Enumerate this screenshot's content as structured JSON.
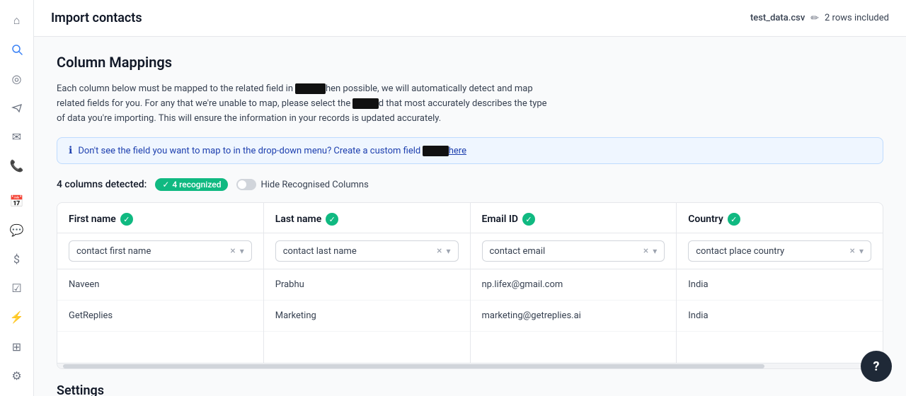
{
  "header": {
    "title": "Import contacts",
    "file_name": "test_data.csv",
    "rows_included": "2 rows included"
  },
  "sidebar": {
    "icons": [
      {
        "name": "home-icon",
        "symbol": "⌂",
        "active": false
      },
      {
        "name": "search-icon",
        "symbol": "🔍",
        "active": true
      },
      {
        "name": "activity-icon",
        "symbol": "◎",
        "active": false
      },
      {
        "name": "campaign-icon",
        "symbol": "📢",
        "active": false
      },
      {
        "name": "mail-icon",
        "symbol": "✉",
        "active": false
      },
      {
        "name": "phone-icon",
        "symbol": "📞",
        "active": false
      },
      {
        "name": "calendar-icon",
        "symbol": "📅",
        "active": false
      },
      {
        "name": "chat-icon",
        "symbol": "💬",
        "active": false
      },
      {
        "name": "dollar-icon",
        "symbol": "$",
        "active": false
      },
      {
        "name": "tasks-icon",
        "symbol": "☑",
        "active": false
      },
      {
        "name": "bolt-icon",
        "symbol": "⚡",
        "active": false
      },
      {
        "name": "grid-icon",
        "symbol": "⊞",
        "active": false
      },
      {
        "name": "settings-icon",
        "symbol": "⚙",
        "active": false
      }
    ]
  },
  "column_mappings": {
    "section_title": "Column Mappings",
    "description_part1": "Each column below must be mapped to the related field in",
    "description_redacted1": "REDACTED",
    "description_part2": "hen possible, we will automatically detect and map related fields for you. For any that we're unable to map, please select the",
    "description_redacted2": "REDACTED",
    "description_part3": "d that most accurately describes the type of data you're importing. This will ensure the information in your records is updated accurately.",
    "info_text": "Don't see the field you want to map to in the drop-down menu? Create a custom field",
    "info_redacted": "REDACTED",
    "info_here": "here",
    "columns_label": "4 columns detected:",
    "recognized_badge": "4 recognized",
    "hide_label": "Hide Recognised Columns"
  },
  "columns": [
    {
      "id": "first_name",
      "header": "First name",
      "mapped_value": "contact first name",
      "rows": [
        "Naveen",
        "GetReplies"
      ]
    },
    {
      "id": "last_name",
      "header": "Last name",
      "mapped_value": "contact last name",
      "rows": [
        "Prabhu",
        "Marketing"
      ]
    },
    {
      "id": "email_id",
      "header": "Email ID",
      "mapped_value": "contact email",
      "rows": [
        "np.lifex@gmail.com",
        "marketing@getreplies.ai"
      ]
    },
    {
      "id": "country",
      "header": "Country",
      "mapped_value": "contact place country",
      "rows": [
        "India",
        "India"
      ]
    }
  ],
  "settings": {
    "title": "Settings"
  },
  "help_btn": "?"
}
